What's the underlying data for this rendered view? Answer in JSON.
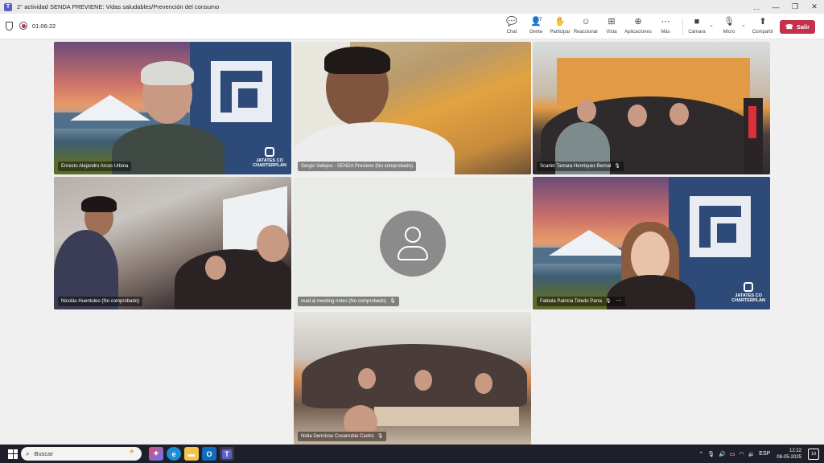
{
  "window": {
    "title": "2° actividad SENDA PREVIENE: Vidas saludables/Prevención del consumo",
    "controls": [
      "…",
      "—",
      "❐",
      "✕"
    ]
  },
  "meeting": {
    "timer": "01:06:22",
    "toolbar": {
      "chat": "Chat",
      "people": "Gente",
      "people_count": "7",
      "raise": "Participar",
      "react": "Reaccionar",
      "view": "Vista",
      "apps": "Aplicaciones",
      "more": "Más",
      "camera": "Cámara",
      "mic": "Micro",
      "share": "Compartir",
      "leave": "Salir"
    },
    "leave_color": "#c4314b"
  },
  "participants": [
    {
      "name": "Ernesto Alejandro Arcos Urbina"
    },
    {
      "name": "Sergio Vallejos - SENDA Previene (No comprobado)"
    },
    {
      "name": "Scarlet Tamara Henriquez Bernal"
    },
    {
      "name": "Nicolás Huentuleo (No comprobado)"
    },
    {
      "name": "read.ai meeting notes (No comprobado)"
    },
    {
      "name": "Fabiola Patricia Toledo Parra"
    },
    {
      "name": "Nidia Dennisse Covarrubia Castro"
    }
  ],
  "brand": {
    "logo_line1": "JATATES CO",
    "logo_line2": "CHARTERPLAN"
  },
  "taskbar": {
    "search_placeholder": "Buscar",
    "language": "ESP",
    "time": "12:22",
    "date": "08-05-2025",
    "notifications": "10"
  }
}
